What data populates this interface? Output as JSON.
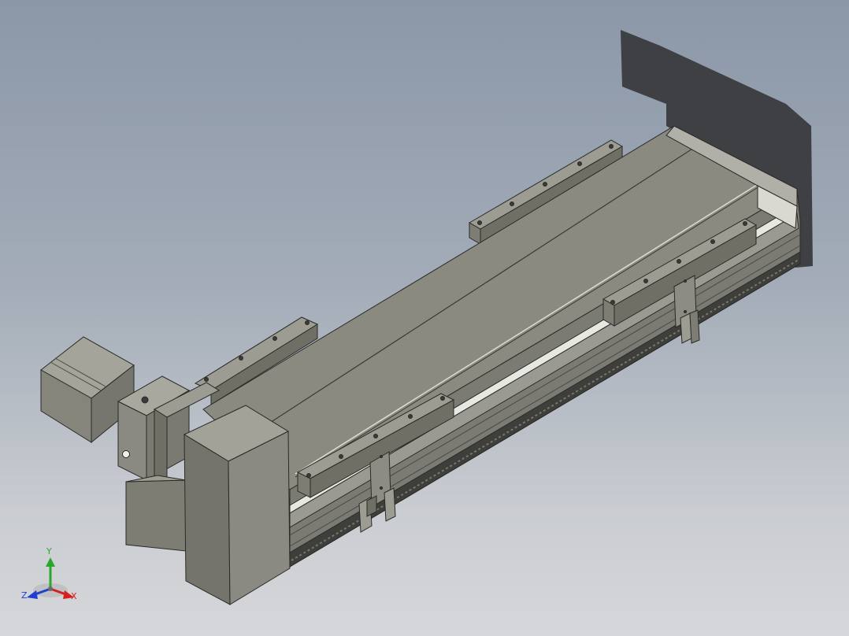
{
  "viewport": {
    "background_top": "#8b97a8",
    "background_bottom": "#d6d7da"
  },
  "model": {
    "description_icon": "linear-actuator-model",
    "body_color": "#8a8a80",
    "edge_color": "#2a2a28"
  },
  "triad": {
    "axis_y": {
      "label": "Y",
      "color": "#2ba82b"
    },
    "axis_x": {
      "label": "X",
      "color": "#d42020"
    },
    "axis_z": {
      "label": "Z",
      "color": "#1f3fd1"
    }
  }
}
